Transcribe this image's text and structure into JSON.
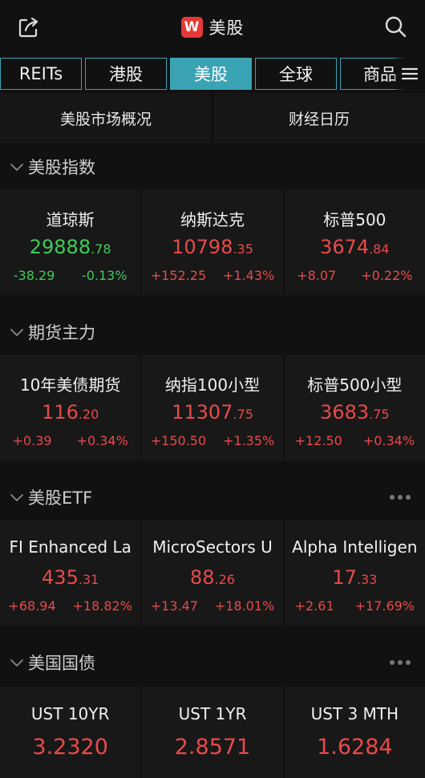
{
  "header": {
    "title": "美股",
    "logo_text": "W"
  },
  "tabs": [
    {
      "label": "REITs",
      "active": false
    },
    {
      "label": "港股",
      "active": false
    },
    {
      "label": "美股",
      "active": true
    },
    {
      "label": "全球",
      "active": false
    },
    {
      "label": "商品",
      "active": false
    }
  ],
  "subnav": {
    "left": "美股市场概况",
    "right": "财经日历"
  },
  "colors": {
    "up": "#e84a4a",
    "down": "#3ecb5a",
    "accent": "#3aa3b4"
  },
  "sections": {
    "indices": {
      "title": "美股指数",
      "items": [
        {
          "name": "道琼斯",
          "price_int": "29888",
          "price_dec": ".78",
          "change": "-38.29",
          "pct": "-0.13%",
          "dir": "down"
        },
        {
          "name": "纳斯达克",
          "price_int": "10798",
          "price_dec": ".35",
          "change": "+152.25",
          "pct": "+1.43%",
          "dir": "up"
        },
        {
          "name": "标普500",
          "price_int": "3674",
          "price_dec": ".84",
          "change": "+8.07",
          "pct": "+0.22%",
          "dir": "up"
        }
      ]
    },
    "futures": {
      "title": "期货主力",
      "items": [
        {
          "name": "10年美债期货",
          "price_int": "116",
          "price_dec": ".20",
          "change": "+0.39",
          "pct": "+0.34%",
          "dir": "up"
        },
        {
          "name": "纳指100小型",
          "price_int": "11307",
          "price_dec": ".75",
          "change": "+150.50",
          "pct": "+1.35%",
          "dir": "up"
        },
        {
          "name": "标普500小型",
          "price_int": "3683",
          "price_dec": ".75",
          "change": "+12.50",
          "pct": "+0.34%",
          "dir": "up"
        }
      ]
    },
    "etf": {
      "title": "美股ETF",
      "items": [
        {
          "name": "FI Enhanced La",
          "price_int": "435",
          "price_dec": ".31",
          "change": "+68.94",
          "pct": "+18.82%",
          "dir": "up"
        },
        {
          "name": "MicroSectors U",
          "price_int": "88",
          "price_dec": ".26",
          "change": "+13.47",
          "pct": "+18.01%",
          "dir": "up"
        },
        {
          "name": "Alpha Intelligen",
          "price_int": "17",
          "price_dec": ".33",
          "change": "+2.61",
          "pct": "+17.69%",
          "dir": "up"
        }
      ]
    },
    "bonds": {
      "title": "美国国债",
      "items": [
        {
          "name": "UST 10YR",
          "value": "3.2320"
        },
        {
          "name": "UST 1YR",
          "value": "2.8571"
        },
        {
          "name": "UST 3 MTH",
          "value": "1.6284"
        }
      ]
    }
  }
}
